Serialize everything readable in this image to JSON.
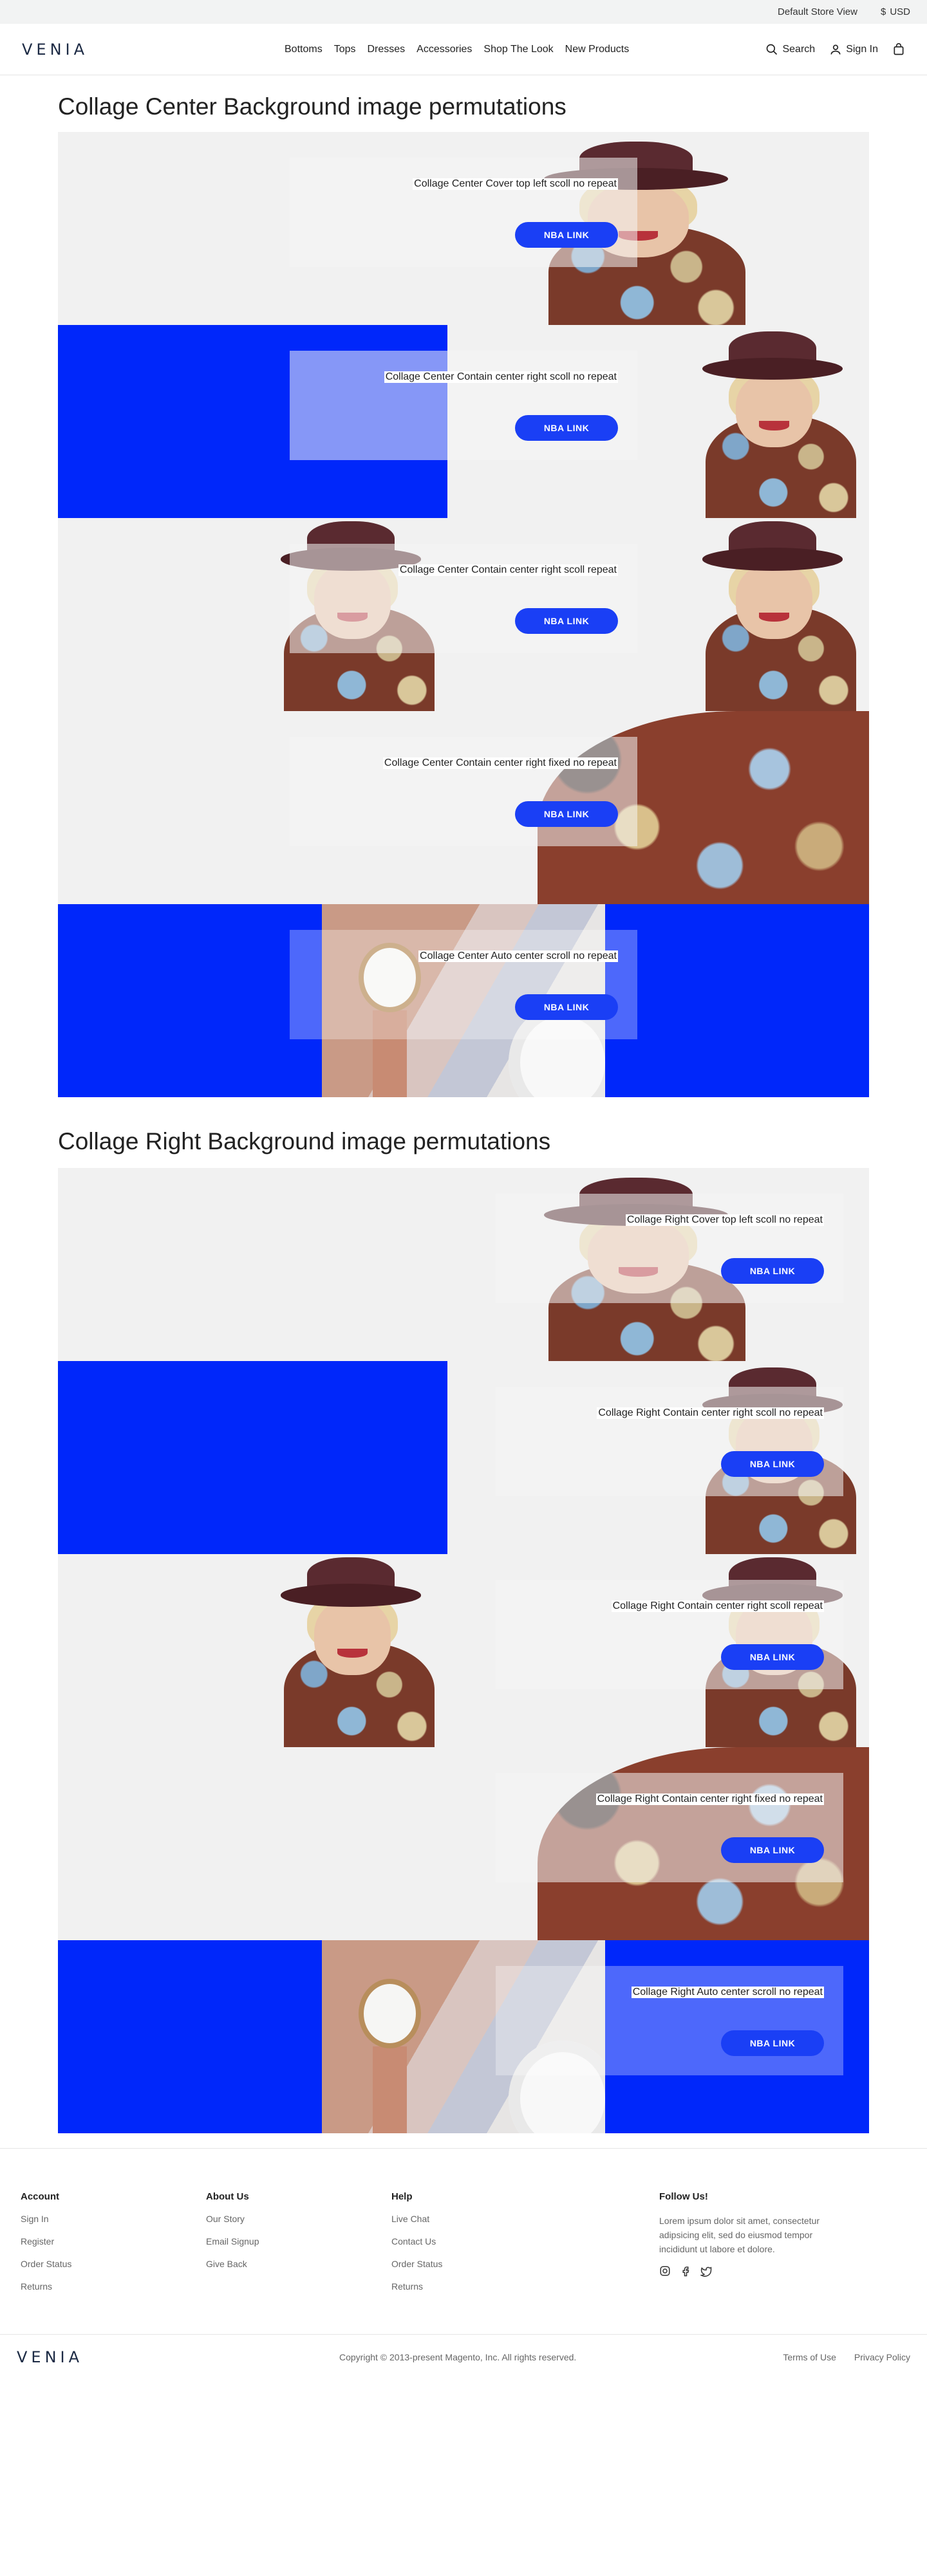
{
  "topbar": {
    "store": "Default Store View",
    "currency_symbol": "$",
    "currency": "USD"
  },
  "header": {
    "logo": "VENIA",
    "nav": [
      "Bottoms",
      "Tops",
      "Dresses",
      "Accessories",
      "Shop The Look",
      "New Products"
    ],
    "search": "Search",
    "signin": "Sign In"
  },
  "sections": [
    {
      "title": "Collage Center Background image permutations",
      "tiles": [
        {
          "label": "Collage Center Cover top left scoll no repeat",
          "button": "NBA LINK"
        },
        {
          "label": "Collage Center Contain center right scoll no repeat",
          "button": "NBA LINK"
        },
        {
          "label": "Collage Center Contain center right scoll repeat",
          "button": "NBA LINK"
        },
        {
          "label": "Collage Center Contain center right fixed no repeat",
          "button": "NBA LINK"
        },
        {
          "label": "Collage Center Auto center  scroll no repeat",
          "button": "NBA LINK"
        }
      ]
    },
    {
      "title": "Collage Right Background image permutations",
      "tiles": [
        {
          "label": "Collage Right Cover top left scoll no repeat",
          "button": "NBA LINK"
        },
        {
          "label": "Collage Right Contain center right scoll no repeat",
          "button": "NBA LINK"
        },
        {
          "label": "Collage Right Contain center right scoll repeat",
          "button": "NBA LINK"
        },
        {
          "label": "Collage Right Contain center right fixed no repeat",
          "button": "NBA LINK"
        },
        {
          "label": "Collage Right Auto center  scroll no repeat",
          "button": "NBA LINK"
        }
      ]
    }
  ],
  "footer": {
    "account": {
      "title": "Account",
      "links": [
        "Sign In",
        "Register",
        "Order Status",
        "Returns"
      ]
    },
    "about": {
      "title": "About Us",
      "links": [
        "Our Story",
        "Email Signup",
        "Give Back"
      ]
    },
    "help": {
      "title": "Help",
      "links": [
        "Live Chat",
        "Contact Us",
        "Order Status",
        "Returns"
      ]
    },
    "follow": {
      "title": "Follow Us!",
      "text": "Lorem ipsum dolor sit amet, consectetur adipsicing elit, sed do eiusmod tempor incididunt ut labore et dolore."
    },
    "logo": "VENIA",
    "copyright": "Copyright © 2013-present Magento, Inc. All rights reserved.",
    "terms": "Terms of Use",
    "privacy": "Privacy Policy"
  },
  "colors": {
    "accent_blue": "#0027fa",
    "button_blue": "#1a3ff5"
  }
}
